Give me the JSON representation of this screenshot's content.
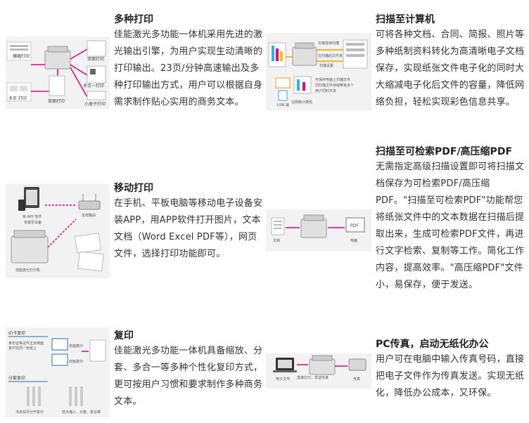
{
  "features": [
    {
      "title": "多种打印",
      "body": "佳能激光多功能一体机采用先进的激光输出引擎，为用户实现生动清晰的打印输出。23页/分钟高速输出及多种打印输出方式，用户可以根据自身需求制作贴心实用的商务文本。",
      "image_labels": [
        "横幅打印",
        "多合一打印",
        "单面打印",
        "双面打印",
        "小册子打印",
        "多页 打印"
      ]
    },
    {
      "title": "扫描至计算机",
      "body": "可将各种文档、合同、简报、照片等多种纸制资料转化为高清晰电子文档保存，实现纸张文件电子化的同时大大缩减电子化后文件的容量，降低网络负担，轻松实现彩色信息共享。",
      "image_labels": [
        "文稿连续扫描",
        "在扫描后文件夹",
        "扫描设置",
        "可保存电脑上扫描文件",
        "同扫描文件存储带来多个",
        "用户同时共享",
        "USB 端",
        "在网络计算机"
      ]
    },
    {
      "title": "移动打印",
      "body": "在手机、平板电脑等移动电子设备安装APP，用APP软件打开图片，文本文档（Word Excel PDF等），网页文件，选择打印功能即可。",
      "image_labels": [
        "将 APP 软件",
        "安装至设备",
        "无线路由",
        "佳能激光打印机"
      ]
    },
    {
      "title": "扫描至可检索PDF/高压缩PDF",
      "body": "无需指定高级扫描设置即可将扫描文档保存为可检索PDF/高压缩PDF。\"扫描至可检索PDF\"功能帮您将纸张文件中的文本数据在扫描后提取出来，生成可检索PDF文件，再进行文字检索、复制等工作。简化工作内容，提高效率。\"高压缩PDF\"文件小，易保存，便于发送。",
      "image_labels": [
        "文档",
        "PDF",
        "电脑"
      ]
    },
    {
      "title": "复印",
      "body": "佳能激光多功能一体机具备缩放、分套、多合一等多种个性化复印方式，更可按用户习惯和要求制作多种商务文本。",
      "image_labels": [
        "ID卡复印",
        "身份证等证件正反两面",
        "复印在同一张纸上",
        "分套复印",
        "单面复印",
        "双面复印",
        "书本双页分开复印",
        "放大缩小、分套、复合等"
      ]
    },
    {
      "title": "PC传真，启动无纸化办公",
      "body": "用户可在电脑中输入传真号码，直接把电子文件作为传真发送。实现无纸化，降低办公成本，又环保。",
      "image_labels": [
        "电子文件",
        "直接打印，发送传真",
        "传真"
      ]
    }
  ]
}
